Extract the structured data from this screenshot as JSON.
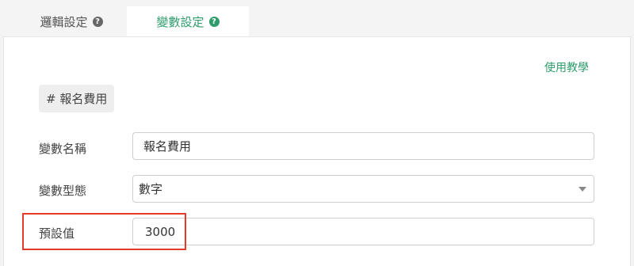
{
  "tabs": [
    {
      "label": "邏輯設定",
      "active": false
    },
    {
      "label": "變數設定",
      "active": true
    }
  ],
  "help_icon_glyph": "?",
  "tutorial_link": "使用教學",
  "variable_tag": "# 報名費用",
  "form": {
    "name_label": "變數名稱",
    "name_value": "報名費用",
    "type_label": "變數型態",
    "type_value": "數字",
    "default_label": "預設值",
    "default_value": "3000"
  },
  "colors": {
    "accent": "#2e9c6b",
    "highlight": "#e53a2a"
  }
}
